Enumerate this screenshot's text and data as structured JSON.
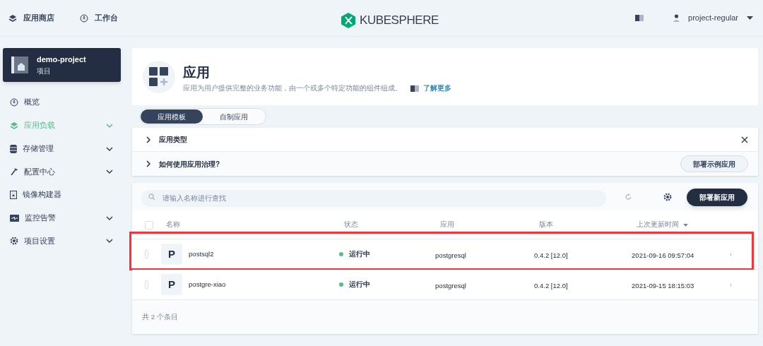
{
  "top_nav": [
    {
      "label": "应用商店",
      "kind": "layers"
    },
    {
      "label": "工作台",
      "kind": "dial"
    }
  ],
  "logo": {
    "text": "KUBESPHERE"
  },
  "user": {
    "name": "project-regular"
  },
  "project": {
    "name": "demo-project",
    "kind_label": "项目"
  },
  "sidebar": {
    "items": [
      {
        "label": "概览",
        "kind": "dial",
        "selected": false,
        "expandable": false
      },
      {
        "label": "应用负载",
        "kind": "layers",
        "selected": true,
        "expandable": true
      },
      {
        "label": "存储管理",
        "kind": "db",
        "selected": false,
        "expandable": true
      },
      {
        "label": "配置中心",
        "kind": "hammer",
        "selected": false,
        "expandable": true
      },
      {
        "label": "镜像构建器",
        "kind": "image",
        "selected": false,
        "expandable": false
      },
      {
        "label": "监控告警",
        "kind": "monitor",
        "selected": false,
        "expandable": true
      },
      {
        "label": "项目设置",
        "kind": "gear",
        "selected": false,
        "expandable": true
      }
    ]
  },
  "header": {
    "title": "应用",
    "description": "应用为用户提供完整的业务功能，由一个或多个特定功能的组件组成。",
    "learn_more": "了解更多"
  },
  "tabs": [
    {
      "label": "应用模板",
      "selected": true
    },
    {
      "label": "自制应用",
      "selected": false
    }
  ],
  "info_panel": {
    "items": [
      {
        "title": "应用类型"
      },
      {
        "title": "如何使用应用治理?"
      }
    ],
    "deploy_sample": "部署示例应用"
  },
  "toolbar": {
    "search_placeholder": "请输入名称进行查找",
    "deploy_new": "部署新应用"
  },
  "table": {
    "select_all_checked": false,
    "columns": [
      "名称",
      "状态",
      "应用",
      "版本",
      "上次更新时间"
    ],
    "rows": [
      {
        "icon_letter": "P",
        "name": "postsql2",
        "status": "运行中",
        "app": "postgresql",
        "version": "0.4.2 [12.0]",
        "updated": "2021-09-16 09:57:04",
        "checked": false,
        "highlighted": true
      },
      {
        "icon_letter": "P",
        "name": "postgre-xiao",
        "status": "运行中",
        "app": "postgresql",
        "version": "0.4.2 [12.0]",
        "updated": "2021-09-15 18:15:03",
        "checked": false,
        "highlighted": false
      }
    ],
    "total": "共 2 个条目"
  }
}
